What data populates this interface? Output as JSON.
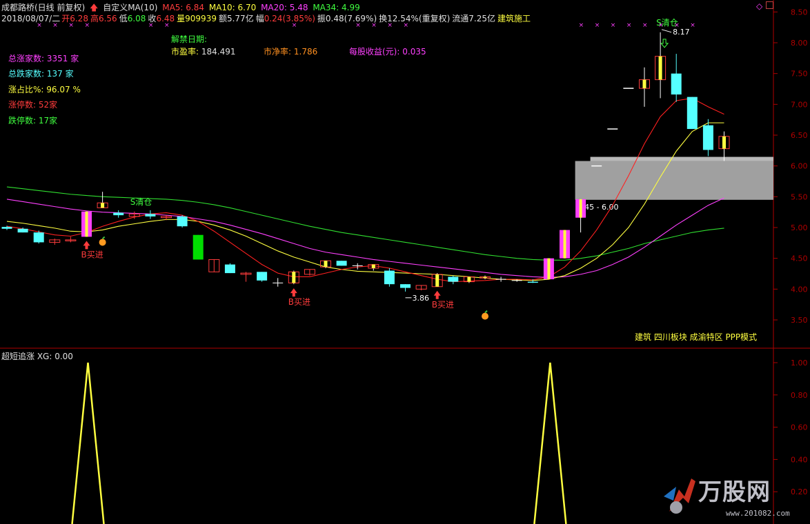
{
  "header": {
    "stock": "成都路桥(日线 前复权)",
    "indicator": "自定义MA(10)",
    "ma5": "MA5: 6.84",
    "ma10": "MA10: 6.70",
    "ma20": "MA20: 5.48",
    "ma34": "MA34: 4.99",
    "date": "2018/08/07/二",
    "open_label": "开",
    "open": "6.28",
    "high_label": "高",
    "high": "6.56",
    "low_label": "低",
    "low": "6.08",
    "close_label": "收",
    "close": "6.48",
    "vol": "量909939",
    "amount": "额5.77亿",
    "change_label": "幅",
    "change": "0.24(3.85%)",
    "amplitude": "振0.48(7.69%)",
    "turnover": "换12.54%(重复权)",
    "float": "流通7.25亿",
    "sector": "建筑施工"
  },
  "info": {
    "unlock": "解禁日期:",
    "pe_label": "市盈率:",
    "pe": "184.491",
    "pb_label": "市净率:",
    "pb": "1.786",
    "eps_label": "每股收益(元):",
    "eps": "0.035"
  },
  "stats": {
    "up_label": "总涨家数:",
    "up": "3351 家",
    "down_label": "总跌家数:",
    "down": "137 家",
    "ratio_label": "涨占比%:",
    "ratio": "96.07 %",
    "limitup_label": "涨停数:",
    "limitup": "52家",
    "limitdown_label": "跌停数:",
    "limitdown": "17家"
  },
  "tags": "建筑 四川板块 成渝特区 PPP模式",
  "sub_title": "超短追涨  XG: 0.00",
  "logo": {
    "text": "万股网",
    "url": "www.201082.com"
  },
  "colors": {
    "up": "#ff3c3c",
    "down": "#55ffff",
    "ma5": "#ffffff",
    "ma10": "#ff2020",
    "ma20": "#ff40ff",
    "ma34": "#30e030",
    "yellow": "#ffff40",
    "axis": "#b00000",
    "zone": "#a0a0a0"
  },
  "chart_data": [
    {
      "type": "candlestick",
      "ylim": [
        3.2,
        8.6
      ],
      "yticks": [
        "3.50",
        "4.00",
        "4.50",
        "5.00",
        "5.50",
        "6.00",
        "6.50",
        "7.00",
        "7.50",
        "8.00",
        "8.50"
      ],
      "ytick_values": [
        3.5,
        4.0,
        4.5,
        5.0,
        5.5,
        6.0,
        6.5,
        7.0,
        7.5,
        8.0,
        8.5
      ],
      "candles": [
        {
          "o": 4.98,
          "h": 5.03,
          "l": 4.96,
          "c": 5.01,
          "fill": "cyan"
        },
        {
          "o": 4.98,
          "h": 5.0,
          "l": 4.92,
          "c": 4.92,
          "fill": "cyan"
        },
        {
          "o": 4.92,
          "h": 4.95,
          "l": 4.74,
          "c": 4.76,
          "fill": "cyan"
        },
        {
          "o": 4.76,
          "h": 4.82,
          "l": 4.72,
          "c": 4.8,
          "fill": "hollow"
        },
        {
          "o": 4.8,
          "h": 4.85,
          "l": 4.76,
          "c": 4.8,
          "fill": "hollow"
        },
        {
          "o": 4.85,
          "h": 5.26,
          "l": 4.85,
          "c": 5.26,
          "fill": "limit"
        },
        {
          "o": 5.32,
          "h": 5.58,
          "l": 5.32,
          "c": 5.4,
          "fill": "yellowbar"
        },
        {
          "o": 5.24,
          "h": 5.28,
          "l": 5.16,
          "c": 5.2,
          "fill": "cyan"
        },
        {
          "o": 5.18,
          "h": 5.26,
          "l": 5.14,
          "c": 5.22,
          "fill": "hollow"
        },
        {
          "o": 5.22,
          "h": 5.28,
          "l": 5.14,
          "c": 5.18,
          "fill": "cyan"
        },
        {
          "o": 5.16,
          "h": 5.2,
          "l": 5.12,
          "c": 5.18,
          "fill": "hollow"
        },
        {
          "o": 5.18,
          "h": 5.2,
          "l": 5.0,
          "c": 5.02,
          "fill": "cyan"
        },
        {
          "o": 4.88,
          "h": 4.88,
          "l": 4.48,
          "c": 4.48,
          "fill": "green"
        },
        {
          "o": 4.28,
          "h": 4.48,
          "l": 4.28,
          "c": 4.48,
          "fill": "hollow"
        },
        {
          "o": 4.4,
          "h": 4.42,
          "l": 4.26,
          "c": 4.26,
          "fill": "cyan"
        },
        {
          "o": 4.26,
          "h": 4.28,
          "l": 4.12,
          "c": 4.24,
          "fill": "hollow"
        },
        {
          "o": 4.28,
          "h": 4.28,
          "l": 4.12,
          "c": 4.14,
          "fill": "cyan"
        },
        {
          "o": 4.1,
          "h": 4.18,
          "l": 4.04,
          "c": 4.1,
          "fill": "cross"
        },
        {
          "o": 4.1,
          "h": 4.3,
          "l": 4.08,
          "c": 4.28,
          "fill": "yellowbar"
        },
        {
          "o": 4.24,
          "h": 4.32,
          "l": 4.22,
          "c": 4.32,
          "fill": "hollow"
        },
        {
          "o": 4.36,
          "h": 4.46,
          "l": 4.34,
          "c": 4.46,
          "fill": "yellowbar"
        },
        {
          "o": 4.46,
          "h": 4.46,
          "l": 4.38,
          "c": 4.38,
          "fill": "cyan"
        },
        {
          "o": 4.38,
          "h": 4.42,
          "l": 4.32,
          "c": 4.38,
          "fill": "cross"
        },
        {
          "o": 4.34,
          "h": 4.4,
          "l": 4.3,
          "c": 4.4,
          "fill": "yellowbar"
        },
        {
          "o": 4.3,
          "h": 4.34,
          "l": 4.04,
          "c": 4.08,
          "fill": "cyan"
        },
        {
          "o": 4.08,
          "h": 4.08,
          "l": 3.96,
          "c": 4.02,
          "fill": "cyan"
        },
        {
          "o": 4.0,
          "h": 4.06,
          "l": 3.98,
          "c": 4.06,
          "fill": "hollow"
        },
        {
          "o": 4.04,
          "h": 4.26,
          "l": 4.04,
          "c": 4.24,
          "fill": "yellowbar"
        },
        {
          "o": 4.2,
          "h": 4.22,
          "l": 4.08,
          "c": 4.12,
          "fill": "cyan"
        },
        {
          "o": 4.12,
          "h": 4.2,
          "l": 4.1,
          "c": 4.2,
          "fill": "yellowbar"
        },
        {
          "o": 4.18,
          "h": 4.22,
          "l": 4.16,
          "c": 4.2,
          "fill": "yellowbar"
        },
        {
          "o": 4.16,
          "h": 4.2,
          "l": 4.12,
          "c": 4.16,
          "fill": "cross"
        },
        {
          "o": 4.14,
          "h": 4.16,
          "l": 4.12,
          "c": 4.14,
          "fill": "cross"
        },
        {
          "o": 4.12,
          "h": 4.16,
          "l": 4.1,
          "c": 4.12,
          "fill": "cyan"
        },
        {
          "o": 4.16,
          "h": 4.5,
          "l": 4.16,
          "c": 4.5,
          "fill": "limit"
        },
        {
          "o": 4.5,
          "h": 4.96,
          "l": 4.5,
          "c": 4.96,
          "fill": "limit"
        },
        {
          "o": 5.16,
          "h": 5.46,
          "l": 4.92,
          "c": 5.46,
          "fill": "limit"
        },
        {
          "o": 6.0,
          "h": 6.0,
          "l": 6.0,
          "c": 6.0,
          "fill": "flat"
        },
        {
          "o": 6.6,
          "h": 6.6,
          "l": 6.6,
          "c": 6.6,
          "fill": "flat"
        },
        {
          "o": 7.26,
          "h": 7.26,
          "l": 7.26,
          "c": 7.26,
          "fill": "flat"
        },
        {
          "o": 7.26,
          "h": 7.6,
          "l": 6.96,
          "c": 7.4,
          "fill": "yellowbar"
        },
        {
          "o": 7.4,
          "h": 8.17,
          "l": 7.1,
          "c": 7.78,
          "fill": "yellowbar"
        },
        {
          "o": 7.5,
          "h": 7.82,
          "l": 7.04,
          "c": 7.16,
          "fill": "cyan"
        },
        {
          "o": 7.12,
          "h": 7.12,
          "l": 6.6,
          "c": 6.6,
          "fill": "cyan"
        },
        {
          "o": 6.66,
          "h": 6.76,
          "l": 6.16,
          "c": 6.26,
          "fill": "cyan"
        },
        {
          "o": 6.28,
          "h": 6.56,
          "l": 6.08,
          "c": 6.48,
          "fill": "yellowbar"
        }
      ],
      "ma5": [
        5.02,
        4.98,
        4.93,
        4.88,
        4.86,
        4.92,
        5.02,
        5.1,
        5.17,
        5.22,
        5.24,
        5.2,
        5.1,
        4.94,
        4.76,
        4.58,
        4.4,
        4.26,
        4.2,
        4.2,
        4.26,
        4.32,
        4.36,
        4.38,
        4.34,
        4.28,
        4.22,
        4.16,
        4.12,
        4.13,
        4.14,
        4.16,
        4.16,
        4.15,
        4.2,
        4.36,
        4.62,
        4.96,
        5.36,
        5.84,
        6.36,
        6.8,
        7.06,
        7.1,
        6.96,
        6.84
      ],
      "ma10": [
        5.1,
        5.07,
        5.03,
        4.99,
        4.94,
        4.93,
        4.96,
        5.02,
        5.06,
        5.1,
        5.13,
        5.13,
        5.1,
        5.04,
        4.96,
        4.86,
        4.74,
        4.62,
        4.52,
        4.44,
        4.36,
        4.32,
        4.29,
        4.28,
        4.27,
        4.26,
        4.25,
        4.24,
        4.22,
        4.2,
        4.18,
        4.16,
        4.15,
        4.14,
        4.16,
        4.22,
        4.34,
        4.5,
        4.72,
        5.0,
        5.38,
        5.82,
        6.24,
        6.56,
        6.7,
        6.7
      ],
      "ma20": [
        5.46,
        5.42,
        5.38,
        5.34,
        5.3,
        5.27,
        5.25,
        5.24,
        5.23,
        5.22,
        5.2,
        5.18,
        5.14,
        5.1,
        5.04,
        4.97,
        4.9,
        4.82,
        4.74,
        4.66,
        4.6,
        4.56,
        4.52,
        4.48,
        4.45,
        4.42,
        4.39,
        4.36,
        4.33,
        4.3,
        4.27,
        4.24,
        4.22,
        4.2,
        4.19,
        4.2,
        4.24,
        4.3,
        4.4,
        4.52,
        4.68,
        4.86,
        5.04,
        5.2,
        5.36,
        5.48
      ],
      "ma34": [
        5.66,
        5.63,
        5.6,
        5.57,
        5.54,
        5.52,
        5.5,
        5.49,
        5.48,
        5.47,
        5.46,
        5.44,
        5.41,
        5.37,
        5.32,
        5.26,
        5.2,
        5.14,
        5.08,
        5.02,
        4.97,
        4.92,
        4.88,
        4.84,
        4.8,
        4.76,
        4.72,
        4.68,
        4.64,
        4.6,
        4.56,
        4.53,
        4.5,
        4.48,
        4.47,
        4.47,
        4.5,
        4.54,
        4.6,
        4.66,
        4.74,
        4.8,
        4.86,
        4.92,
        4.96,
        4.99
      ],
      "zone": {
        "low": 5.45,
        "high": 6.08,
        "start_index": 36,
        "label": "5.45 - 6.00"
      },
      "signals": [
        {
          "index": 5,
          "type": "buy",
          "label": "B买进"
        },
        {
          "index": 18,
          "type": "buy",
          "label": "B买进"
        },
        {
          "index": 27,
          "type": "buy",
          "label": "B买进"
        },
        {
          "index": 8,
          "type": "sell",
          "label": "S清仓"
        },
        {
          "index": 41,
          "type": "sell",
          "label": "S清仓"
        }
      ],
      "high_label": {
        "index": 41,
        "text": "8.17"
      },
      "low_label": {
        "index": 25,
        "text": "3.86"
      }
    },
    {
      "type": "line",
      "title": "超短追涨  XG: 0.00",
      "ylim": [
        0,
        1.1
      ],
      "yticks": [
        "0.20",
        "0.40",
        "0.60",
        "0.80",
        "1.00"
      ],
      "ytick_values": [
        0.2,
        0.4,
        0.6,
        0.8,
        1.0
      ],
      "spikes": [
        5,
        34
      ],
      "values": [
        0,
        0,
        0,
        0,
        0,
        1,
        0,
        0,
        0,
        0,
        0,
        0,
        0,
        0,
        0,
        0,
        0,
        0,
        0,
        0,
        0,
        0,
        0,
        0,
        0,
        0,
        0,
        0,
        0,
        0,
        0,
        0,
        0,
        0,
        1,
        0,
        0,
        0,
        0,
        0,
        0,
        0,
        0,
        0,
        0,
        0
      ]
    }
  ]
}
